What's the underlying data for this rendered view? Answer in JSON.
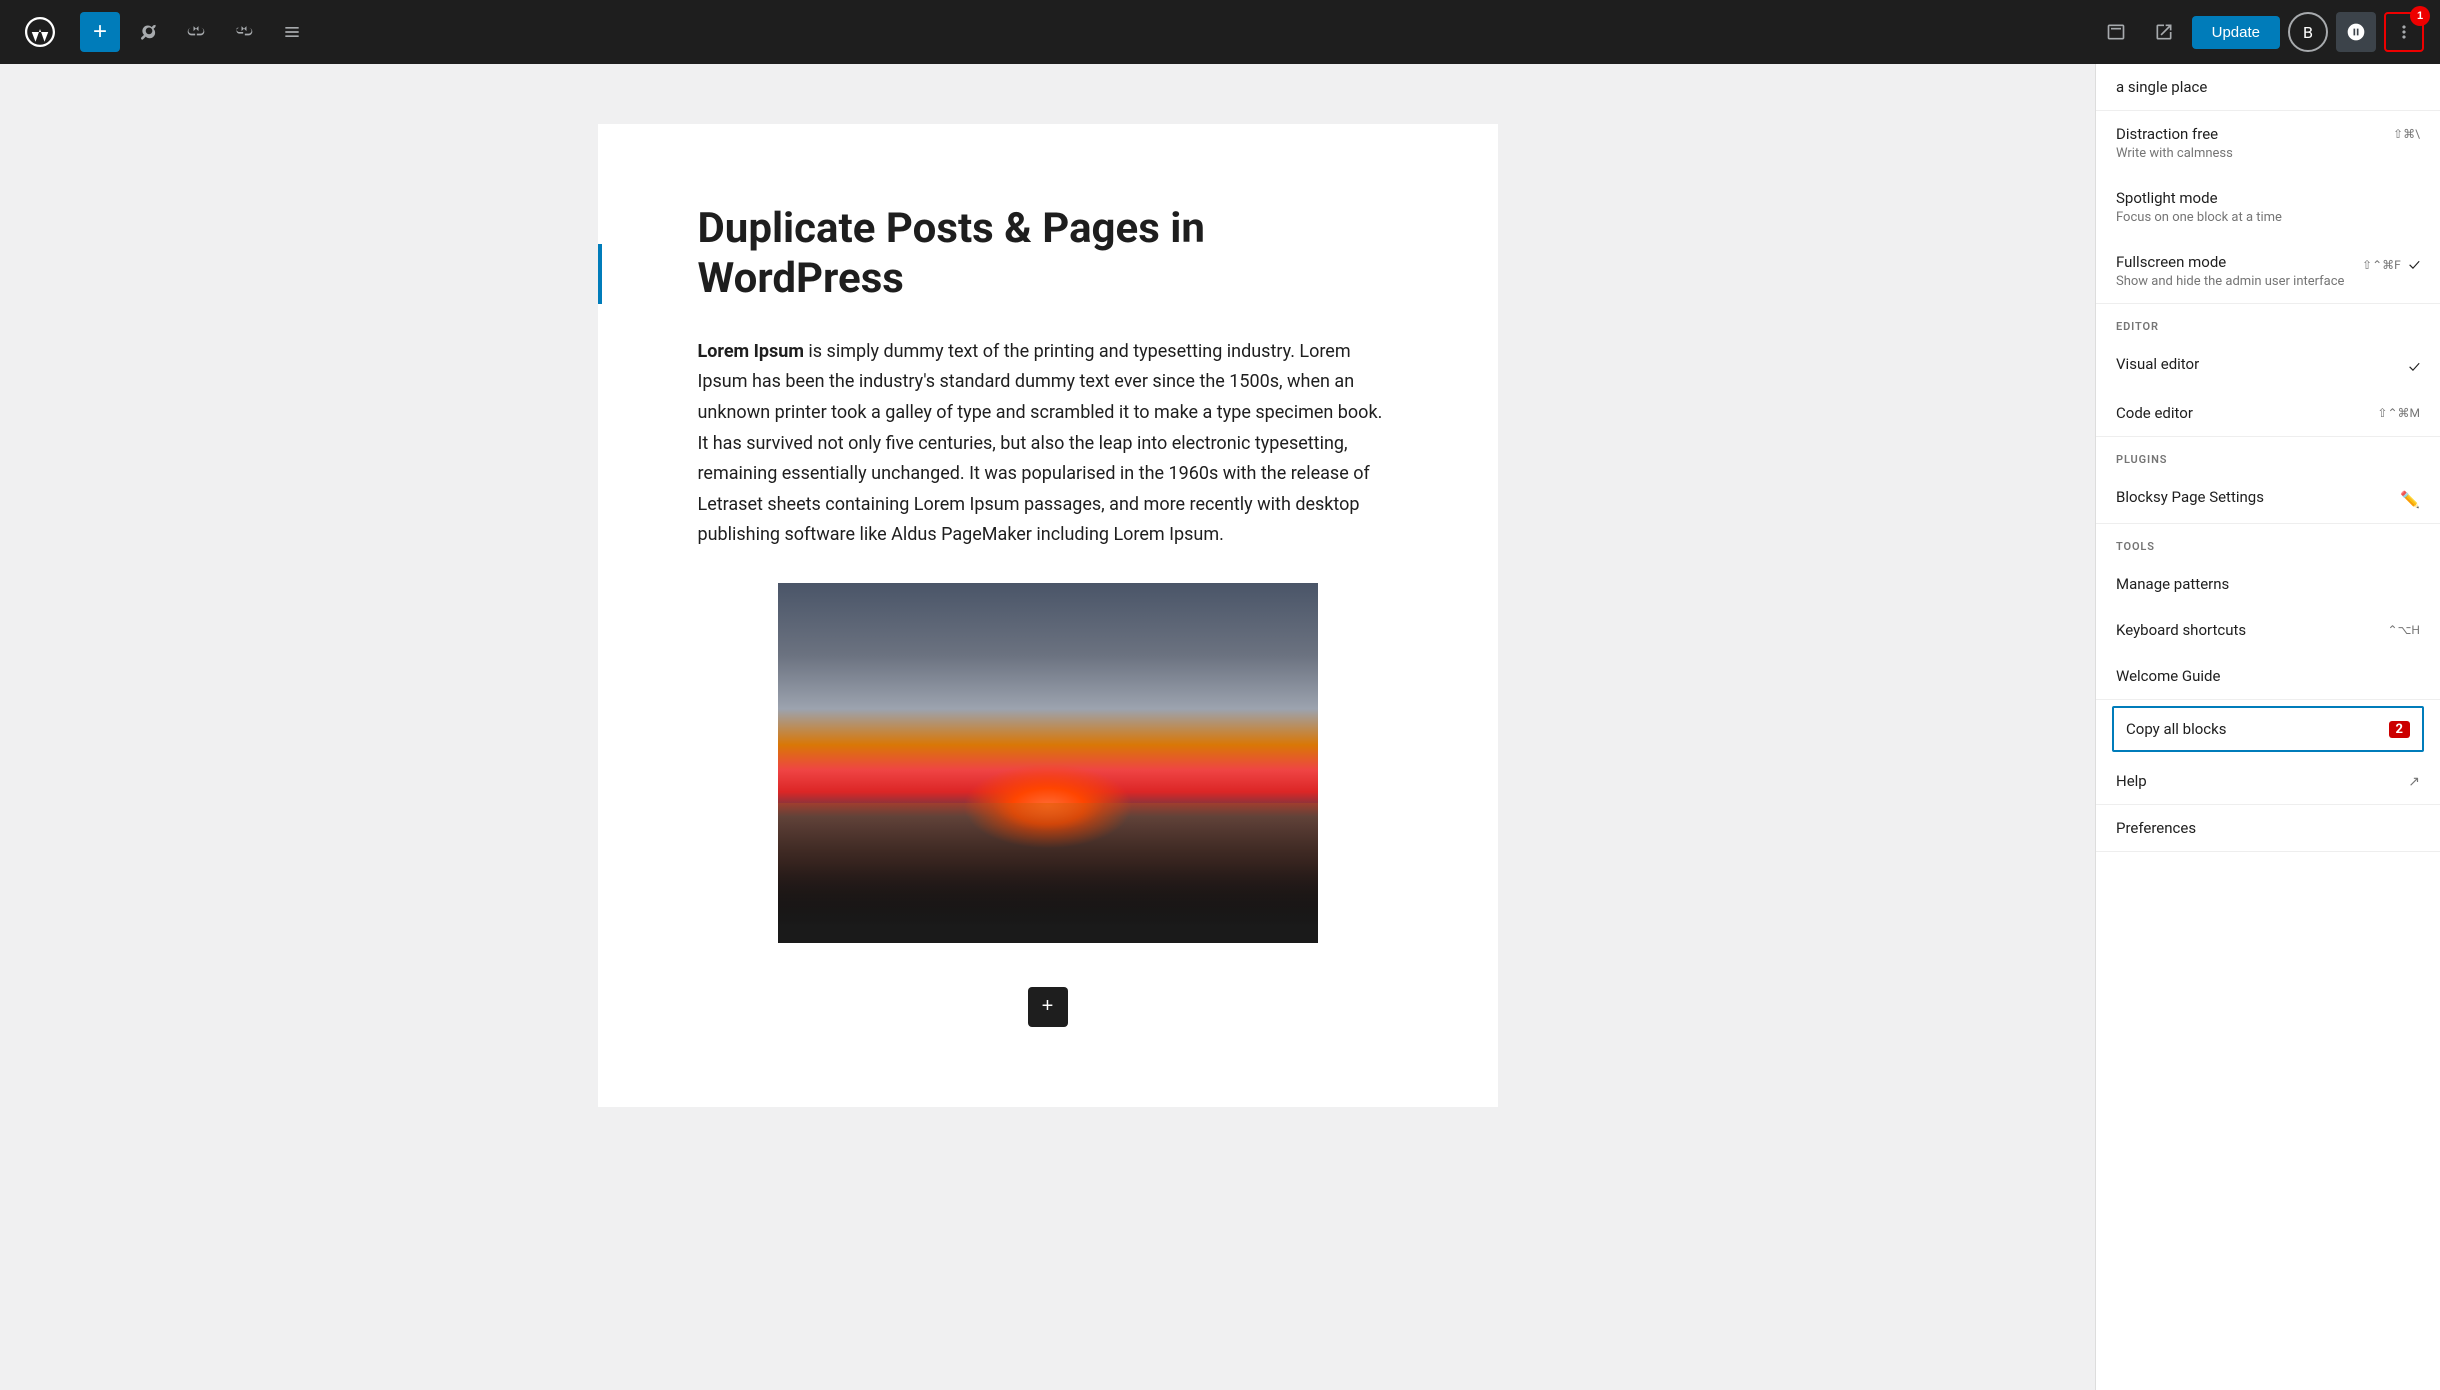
{
  "topbar": {
    "add_label": "+",
    "update_label": "Update",
    "notification_count": "1"
  },
  "editor": {
    "post_title": "Duplicate Posts & Pages in WordPress",
    "paragraph": "Lorem Ipsum is simply dummy text of the printing and typesetting industry. Lorem Ipsum has been the industry's standard dummy text ever since the 1500s, when an unknown printer took a galley of type and scrambled it to make a type specimen book. It has survived not only five centuries, but also the leap into electronic typesetting, remaining essentially unchanged. It was popularised in the 1960s with the release of Letraset sheets containing Lorem Ipsum passages, and more recently with desktop publishing software like Aldus PageMaker including Lorem Ipsum.",
    "paragraph_bold": "Lorem Ipsum"
  },
  "dropdown": {
    "top_text": "a single place",
    "sections": {
      "view": {
        "items": [
          {
            "title": "Distraction free",
            "desc": "Write with calmness",
            "shortcut": "⇧⌘\\",
            "checked": false
          },
          {
            "title": "Spotlight mode",
            "desc": "Focus on one block at a time",
            "shortcut": "",
            "checked": false
          },
          {
            "title": "Fullscreen mode",
            "desc": "Show and hide the admin user interface",
            "shortcut": "⇧⌃⌘F",
            "checked": true
          }
        ]
      },
      "editor": {
        "header": "EDITOR",
        "items": [
          {
            "title": "Visual editor",
            "shortcut": "",
            "checked": true
          },
          {
            "title": "Code editor",
            "shortcut": "⇧⌃⌘M",
            "checked": false
          }
        ]
      },
      "plugins": {
        "header": "PLUGINS",
        "items": [
          {
            "title": "Blocksy Page Settings",
            "icon": "pencil"
          }
        ]
      },
      "tools": {
        "header": "TOOLS",
        "items": [
          {
            "title": "Manage patterns",
            "shortcut": ""
          },
          {
            "title": "Keyboard shortcuts",
            "shortcut": "⌃⌥H"
          },
          {
            "title": "Welcome Guide",
            "shortcut": ""
          }
        ]
      },
      "copy_all_blocks": {
        "title": "Copy all blocks",
        "count": "2"
      },
      "help": {
        "title": "Help",
        "external": true
      },
      "preferences": {
        "title": "Preferences"
      }
    }
  }
}
